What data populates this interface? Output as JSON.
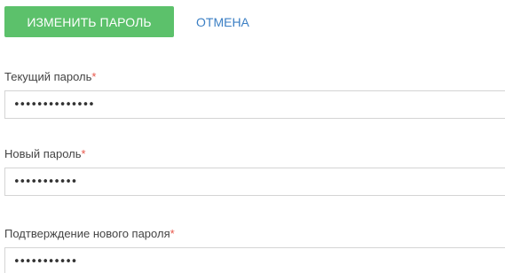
{
  "toolbar": {
    "change_password_label": "ИЗМЕНИТЬ ПАРОЛЬ",
    "cancel_label": "ОТМЕНА"
  },
  "fields": {
    "current_password": {
      "label": "Текущий пароль",
      "required_mark": "*",
      "masked_value": "••••••••••••••"
    },
    "new_password": {
      "label": "Новый пароль",
      "required_mark": "*",
      "masked_value": "•••••••••••"
    },
    "confirm_password": {
      "label": "Подтверждение нового пароля",
      "required_mark": "*",
      "masked_value": "•••••••••••"
    }
  },
  "colors": {
    "primary_button": "#5cc16b",
    "link": "#3b7fc4",
    "required": "#e8564a",
    "input_border": "#d4d4d4"
  }
}
